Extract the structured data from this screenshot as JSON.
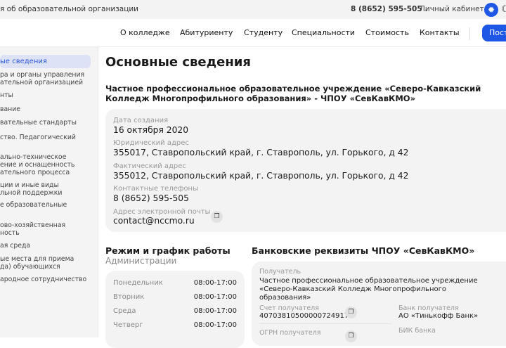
{
  "topbar": {
    "org_info": "я об образовательной организации",
    "phone": "8 (8652) 595-505",
    "cabinet": "Личный кабинет"
  },
  "nav": {
    "items": [
      "О колледже",
      "Абитуриенту",
      "Студенту",
      "Специальности",
      "Стоимость",
      "Контакты"
    ],
    "cta": "Пост"
  },
  "sidebar": {
    "items": [
      "ые сведения",
      "ра и органы управления\nательной организацией",
      "нты",
      "вание",
      "вательные стандарты",
      "ство. Педагогический",
      "ально-техническое\nение и оснащенность\nательного процесса",
      "ции и иные виды\nльной поддержки",
      "е образовательные",
      "ово-хозяйственная\nность",
      "ая среда",
      "ые места для приема\nда) обучающихся",
      "ародное сотрудничество"
    ]
  },
  "main": {
    "title": "Основные сведения",
    "org_name": "Частное профессиональное образовательное учреждение «Северо-Кавказский Колледж Многопрофильного образования» - ЧПОУ «СевКавКМО»",
    "info": [
      {
        "label": "Дата создания",
        "value": "16 октября 2020"
      },
      {
        "label": "Юридический адрес",
        "value": "355017, Ставропольский край, г. Ставрополь, ул. Горького, д 42"
      },
      {
        "label": "Фактический адрес",
        "value": "355012, Ставропольский край, г. Ставрополь, ул. Горького, д 42"
      },
      {
        "label": "Контактные телефоны",
        "value": "8 (8652) 595-505"
      },
      {
        "label": "Адрес электронной почты",
        "value": "contact@nccmo.ru"
      }
    ],
    "schedule": {
      "title": "Режим и график работы",
      "subtitle": "Администрации",
      "rows": [
        {
          "day": "Понедельник",
          "time": "08:00-17:00"
        },
        {
          "day": "Вторник",
          "time": "08:00-17:00"
        },
        {
          "day": "Среда",
          "time": "08:00-17:00"
        },
        {
          "day": "Четверг",
          "time": "08:00-17:00"
        }
      ]
    },
    "bank": {
      "title": "Банковские реквизиты ЧПОУ «СевКавКМО»",
      "recipient_label": "Получатель",
      "recipient": "Частное профессиональное образовательное учреждение «Северо-Кавказский Колледж Многопрофильного образования»",
      "account_label": "Счет получателя",
      "account": "40703810500000724917",
      "bank_label": "Банк получателя",
      "bank": "АО «Тинькофф Банк»",
      "ogrn_label": "ОГРН получателя",
      "bik_label": "БИК банка"
    }
  }
}
